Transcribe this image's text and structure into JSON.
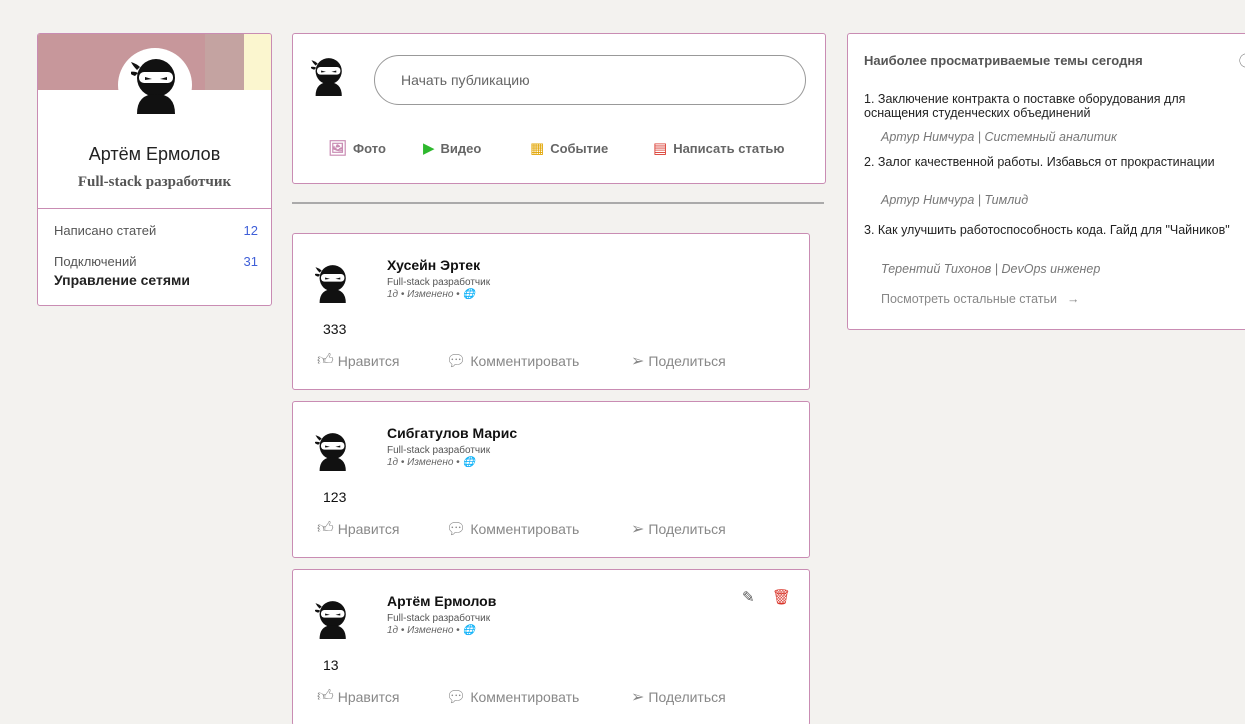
{
  "profile": {
    "name": "Артём Ермолов",
    "title": "Full-stack разработчик",
    "stats": [
      {
        "label": "Написано статей",
        "value": "12"
      },
      {
        "label": "Подключений",
        "value": "31"
      }
    ],
    "manage_label": "Управление сетями",
    "colors": {
      "cover": "#c7979b",
      "accent": "#fbf6cf",
      "border": "#c98cb3",
      "stat_value": "#3f5fd8"
    }
  },
  "share": {
    "placeholder": "Начать публикацию",
    "actions": [
      {
        "label": "Фото",
        "icon": "photo-icon",
        "color": "#c98cb3"
      },
      {
        "label": "Видео",
        "icon": "play-icon",
        "color": "#2eb82e"
      },
      {
        "label": "Событие",
        "icon": "calendar-icon",
        "color": "#e2a400"
      },
      {
        "label": "Написать статью",
        "icon": "article-icon",
        "color": "#d9362b"
      }
    ]
  },
  "post_actions": {
    "like": "Нравится",
    "comment": "Комментировать",
    "share": "Поделиться"
  },
  "posts": [
    {
      "author": "Хусейн Эртек",
      "role": "Full-stack разработчик",
      "meta": "1д • Изменено • 🌐",
      "content": "333",
      "own": false
    },
    {
      "author": "Сибгатулов Марис",
      "role": "Full-stack разработчик",
      "meta": "1д • Изменено • 🌐",
      "content": "123",
      "own": false
    },
    {
      "author": "Артём Ермолов",
      "role": "Full-stack разработчик",
      "meta": "1д • Изменено • 🌐",
      "content": "13",
      "own": true
    }
  ],
  "trending": {
    "heading": "Наиболее просматриваемые темы сегодня",
    "topics": [
      {
        "title": "1. Заключение контракта о поставке оборудования для оснащения студенческих объединений",
        "author": "Артур Нимчура | Системный аналитик"
      },
      {
        "title": "2. Залог качественной работы. Избавься от прокрастинации",
        "author": "Артур Нимчура | Тимлид"
      },
      {
        "title": "3. Как улучшить работоспособность кода. Гайд для \"Чайников\"",
        "author": "Терентий Тихонов | DevOps инженер"
      }
    ],
    "more_label": "Посмотреть остальные статьи",
    "more_arrow": "→"
  }
}
